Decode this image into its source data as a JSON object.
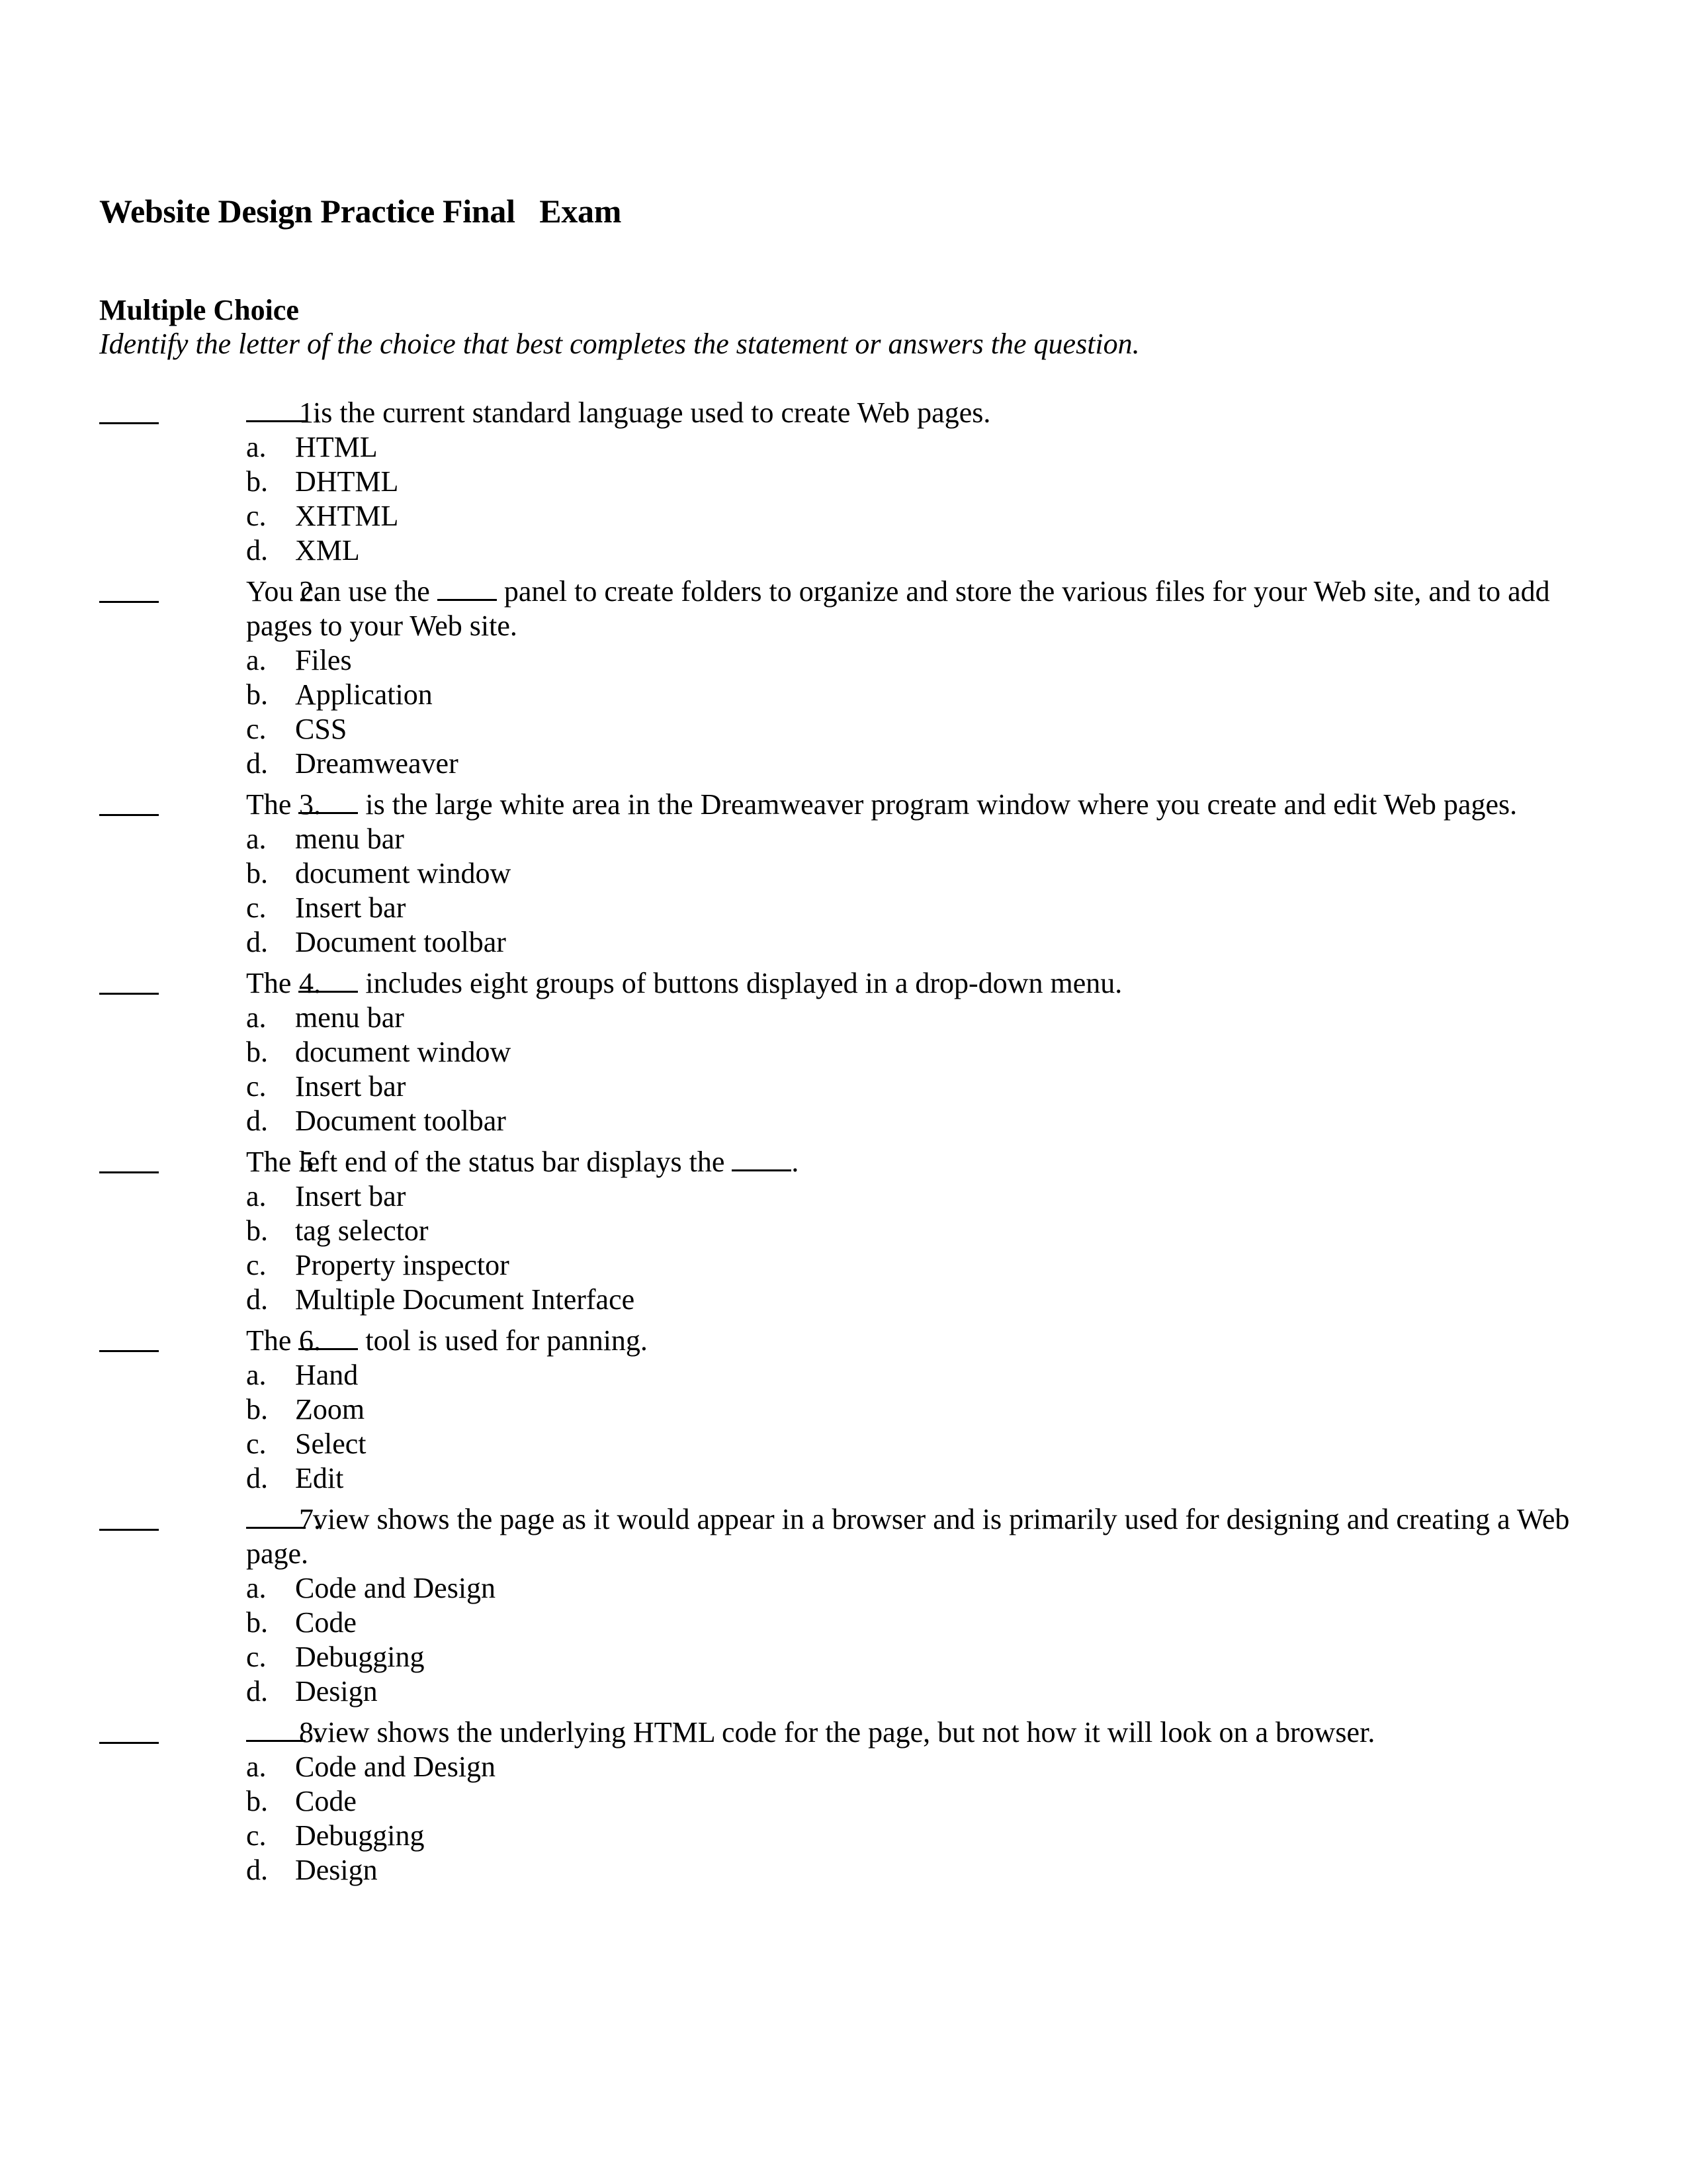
{
  "document": {
    "title": "Website Design Practice Final   Exam",
    "section": "Multiple Choice",
    "instructions": "Identify the letter of the choice that best completes the statement or answers the question."
  },
  "questions": [
    {
      "number": "1.",
      "stem_before": "",
      "stem_after": " is the current standard language used to create Web pages.",
      "options": [
        {
          "letter": "a.",
          "text": "HTML"
        },
        {
          "letter": "b.",
          "text": "DHTML"
        },
        {
          "letter": "c.",
          "text": "XHTML"
        },
        {
          "letter": "d.",
          "text": "XML"
        }
      ]
    },
    {
      "number": "2.",
      "stem_before": "You can use the ",
      "stem_after": " panel to create folders to organize and store the various files for your Web site, and to add pages to your Web site.",
      "options": [
        {
          "letter": "a.",
          "text": "Files"
        },
        {
          "letter": "b.",
          "text": "Application"
        },
        {
          "letter": "c.",
          "text": "CSS"
        },
        {
          "letter": "d.",
          "text": "Dreamweaver"
        }
      ]
    },
    {
      "number": "3.",
      "stem_before": "The ",
      "stem_after": " is the large white area in the Dreamweaver program window where you create and edit Web pages.",
      "options": [
        {
          "letter": "a.",
          "text": "menu bar"
        },
        {
          "letter": "b.",
          "text": "document window"
        },
        {
          "letter": "c.",
          "text": "Insert bar"
        },
        {
          "letter": "d.",
          "text": "Document toolbar"
        }
      ]
    },
    {
      "number": "4.",
      "stem_before": "The ",
      "stem_after": " includes eight groups of buttons displayed in a drop-down menu.",
      "options": [
        {
          "letter": "a.",
          "text": "menu bar"
        },
        {
          "letter": "b.",
          "text": "document window"
        },
        {
          "letter": "c.",
          "text": "Insert bar"
        },
        {
          "letter": "d.",
          "text": "Document toolbar"
        }
      ]
    },
    {
      "number": "5.",
      "stem_before": "The left end of the status bar displays the ",
      "stem_after": ".",
      "options": [
        {
          "letter": "a.",
          "text": "Insert bar"
        },
        {
          "letter": "b.",
          "text": "tag selector"
        },
        {
          "letter": "c.",
          "text": "Property inspector"
        },
        {
          "letter": "d.",
          "text": "Multiple Document Interface"
        }
      ]
    },
    {
      "number": "6.",
      "stem_before": "The ",
      "stem_after": " tool is used for panning.",
      "options": [
        {
          "letter": "a.",
          "text": "Hand"
        },
        {
          "letter": "b.",
          "text": "Zoom"
        },
        {
          "letter": "c.",
          "text": "Select"
        },
        {
          "letter": "d.",
          "text": "Edit"
        }
      ]
    },
    {
      "number": "7.",
      "stem_before": "",
      "stem_after": " view shows the page as it would appear in a browser and is primarily used for designing and creating a Web page.",
      "options": [
        {
          "letter": "a.",
          "text": "Code and Design"
        },
        {
          "letter": "b.",
          "text": "Code"
        },
        {
          "letter": "c.",
          "text": "Debugging"
        },
        {
          "letter": "d.",
          "text": "Design"
        }
      ]
    },
    {
      "number": "8.",
      "stem_before": "",
      "stem_after": " view shows the underlying HTML code for the page, but not how it will look on a browser.",
      "options": [
        {
          "letter": "a.",
          "text": "Code and Design"
        },
        {
          "letter": "b.",
          "text": "Code"
        },
        {
          "letter": "c.",
          "text": "Debugging"
        },
        {
          "letter": "d.",
          "text": "Design"
        }
      ]
    }
  ]
}
